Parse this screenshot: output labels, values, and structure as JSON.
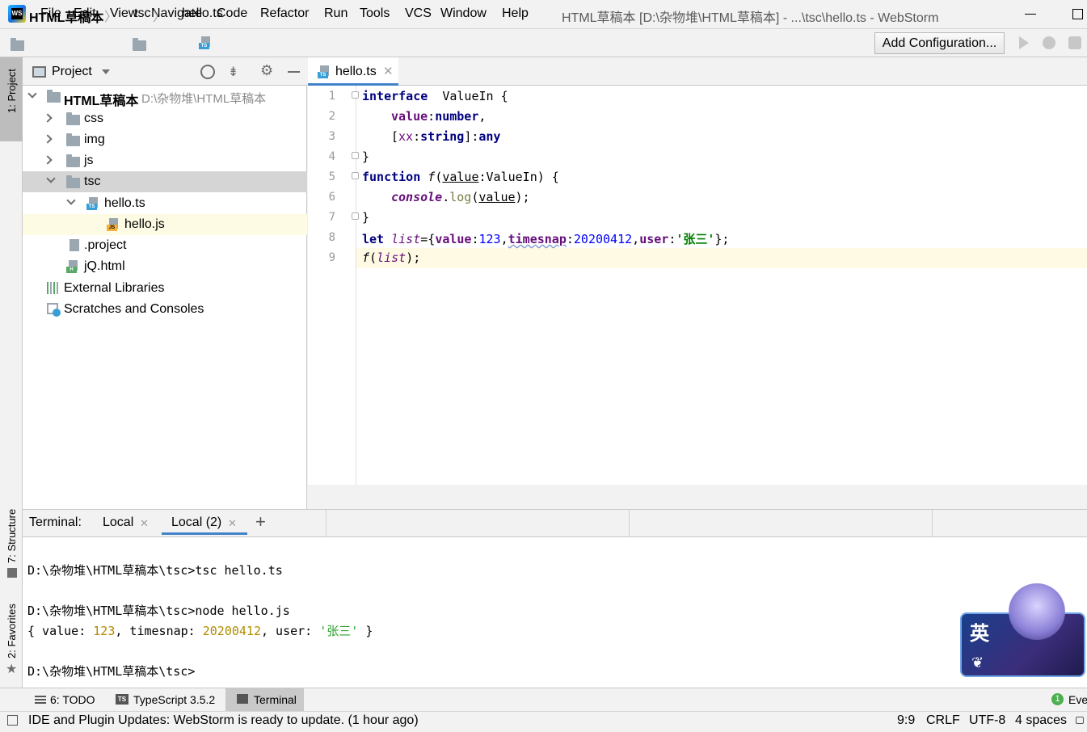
{
  "app": {
    "logo_text": "WS",
    "window_title": "HTML草稿本 [D:\\杂物堆\\HTML草稿本] - ...\\tsc\\hello.ts - WebStorm"
  },
  "menu": [
    "File",
    "Edit",
    "View",
    "Navigate",
    "Code",
    "Refactor",
    "Run",
    "Tools",
    "VCS",
    "Window",
    "Help"
  ],
  "breadcrumb": [
    "HTML草稿本",
    "tsc",
    "hello.ts"
  ],
  "toolbar": {
    "add_configuration": "Add Configuration..."
  },
  "left_stripe": {
    "project": "1: Project",
    "structure": "7: Structure",
    "favorites": "2: Favorites"
  },
  "project_panel": {
    "title": "Project",
    "root": {
      "name": "HTML草稿本",
      "path": "D:\\杂物堆\\HTML草稿本"
    },
    "items": [
      {
        "name": "css"
      },
      {
        "name": "img"
      },
      {
        "name": "js"
      },
      {
        "name": "tsc"
      },
      {
        "name": "hello.ts"
      },
      {
        "name": "hello.js"
      },
      {
        "name": ".project"
      },
      {
        "name": "jQ.html"
      },
      {
        "name": "External Libraries"
      },
      {
        "name": "Scratches and Consoles"
      }
    ]
  },
  "editor": {
    "tab": "hello.ts",
    "line_numbers": [
      "1",
      "2",
      "3",
      "4",
      "5",
      "6",
      "7",
      "8",
      "9"
    ],
    "code": {
      "l1_kw": "interface",
      "l1_rest": "  ValueIn {",
      "l2_field": "value",
      "l2_colon": ":",
      "l2_type": "number",
      "l2_comma": ",",
      "l3_open": "[",
      "l3_xx": "xx",
      "l3_colon": ":",
      "l3_type": "string",
      "l3_close": "]:",
      "l3_any": "any",
      "l4": "}",
      "l5_kw": "function",
      "l5_f": "f",
      "l5_open": "(",
      "l5_param": "value",
      "l5_rest": ":ValueIn) {",
      "l6_console": "console",
      "l6_dot": ".",
      "l6_log": "log",
      "l6_open": "(",
      "l6_arg": "value",
      "l6_close": ");",
      "l7": "}",
      "l8_kw": "let",
      "l8_var": "list",
      "l8_eq": "={",
      "l8_k1": "value",
      "l8_c1": ":",
      "l8_v1": "123",
      "l8_s1": ",",
      "l8_k2": "timesnap",
      "l8_c2": ":",
      "l8_v2": "20200412",
      "l8_s2": ",",
      "l8_k3": "user",
      "l8_c3": ":",
      "l8_v3": "'张三'",
      "l8_end": "};",
      "l9_f": "f",
      "l9_open": "(",
      "l9_var": "list",
      "l9_close": ");"
    }
  },
  "terminal": {
    "label": "Terminal:",
    "tabs": [
      "Local",
      "Local (2)"
    ],
    "new_tab": "+",
    "lines": {
      "cmd1": "D:\\杂物堆\\HTML草稿本\\tsc>tsc hello.ts",
      "cmd2": "D:\\杂物堆\\HTML草稿本\\tsc>node hello.js",
      "out_a": "{ value: ",
      "out_v1": "123",
      "out_b": ", timesnap: ",
      "out_v2": "20200412",
      "out_c": ", user: ",
      "out_v3": "'张三'",
      "out_d": " }",
      "prompt": "D:\\杂物堆\\HTML草稿本\\tsc>"
    }
  },
  "bottom_tools": {
    "todo": "6: TODO",
    "typescript": "TypeScript 3.5.2",
    "terminal": "Terminal",
    "event_count": "1",
    "event_label": "Even"
  },
  "status": {
    "message": "IDE and Plugin Updates: WebStorm is ready to update. (1 hour ago)",
    "position": "9:9",
    "line_sep": "CRLF",
    "encoding": "UTF-8",
    "indent": "4 spaces"
  },
  "ime": {
    "label": "英"
  },
  "colors": {
    "accent": "#4083c9",
    "keyword": "#000080",
    "field": "#660e7a",
    "string": "#008000",
    "current_line": "#fffae3",
    "selected_row": "#d5d5d5"
  }
}
